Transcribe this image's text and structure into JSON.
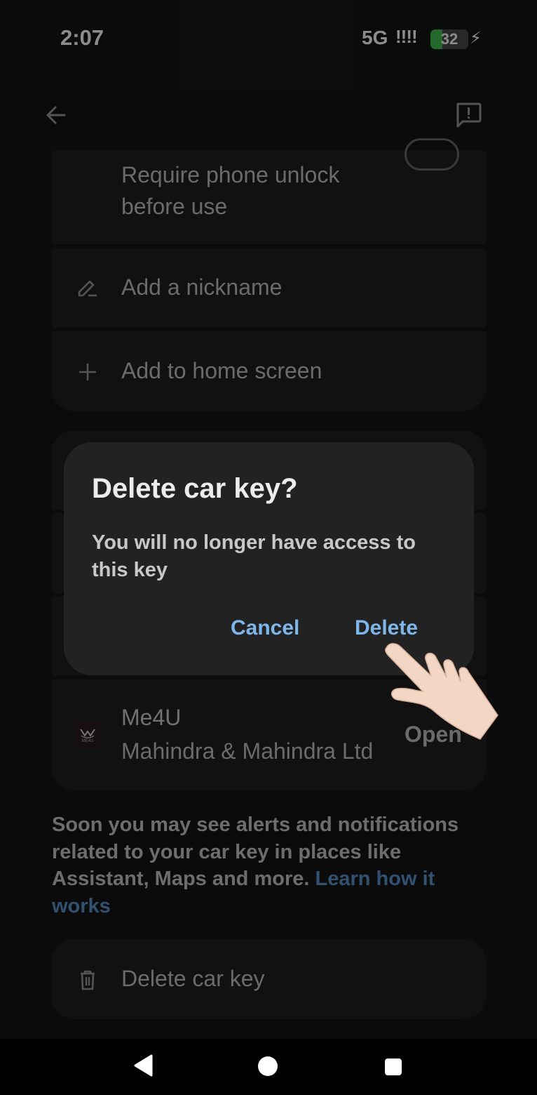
{
  "status_bar": {
    "time": "2:07",
    "network": "5G",
    "signal": "!!!!",
    "battery": "32"
  },
  "settings": {
    "lock_description_line1": "Require phone unlock",
    "lock_description_line2": "before use",
    "add_nickname": "Add a nickname",
    "add_home_screen": "Add to home screen"
  },
  "app_card": {
    "name": "Me4U",
    "developer": "Mahindra & Mahindra Ltd",
    "open_label": "Open",
    "logo_text": "ME4U"
  },
  "info": {
    "text": "Soon you may see alerts and notifications related to your car key in places like Assistant, Maps and more.",
    "link": "Learn how it works"
  },
  "delete_key": {
    "label": "Delete car key"
  },
  "dialog": {
    "title": "Delete car key?",
    "body": "You will no longer have access to this key",
    "cancel": "Cancel",
    "confirm": "Delete"
  },
  "colors": {
    "background": "#151515",
    "card": "#1f1f1f",
    "dialog": "#222222",
    "accent": "#7fb6ea",
    "link": "#5b93cc",
    "battery_green": "#3fbf4f"
  }
}
